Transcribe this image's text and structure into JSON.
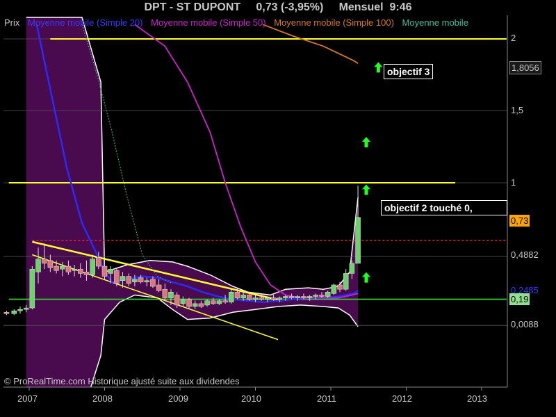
{
  "header": {
    "title": "DPT - ST DUPONT",
    "price": "0,73 (-3,95%)",
    "period": "Mensuel",
    "time": "9:46"
  },
  "legend": [
    {
      "label": "Prix",
      "color": "#c8c8c8"
    },
    {
      "label": "Moyenne mobile (Simple 20)",
      "color": "#3a3aff"
    },
    {
      "label": "Moyenne mobile (Simple 50)",
      "color": "#d020d0"
    },
    {
      "label": "Moyenne mobile (Simple 100)",
      "color": "#d87a20"
    },
    {
      "label": "Moyenne mobile",
      "color": "#3fbf9f"
    }
  ],
  "annotations": {
    "target3": "objectif 3",
    "target2": "objectif 2   touché 0,"
  },
  "copyright": "© ProRealTime.com Historique ajusté suite aux dividendes",
  "colors": {
    "background": "#000000",
    "bollinger_fill": "#4a0a4e",
    "up_candle": "#6ad46a",
    "down_candle": "#d87878",
    "trendline": "#ffff30",
    "resistance": "#ff2020",
    "arrow": "#22ff22"
  },
  "chart_data": {
    "type": "candlestick",
    "title": "DPT - ST DUPONT",
    "x_ticks": [
      "2007",
      "2008",
      "2009",
      "2010",
      "2011",
      "2012",
      "2013"
    ],
    "y_ticks": [
      "0,0088",
      "0,4882",
      "1",
      "1,5",
      "2"
    ],
    "y_markers": [
      {
        "label": "1,8056",
        "value": 1.8056,
        "style": "box-dark"
      },
      {
        "label": "0,73",
        "value": 0.73,
        "style": "box-orange"
      },
      {
        "label": "0,2485",
        "value": 0.2485,
        "style": "label-blue"
      },
      {
        "label": "0,19",
        "value": 0.19,
        "style": "box-green"
      }
    ],
    "ylim": [
      -0.45,
      2.15
    ],
    "candles": [
      {
        "t": 2006.7,
        "o": 0.1,
        "h": 0.11,
        "l": 0.08,
        "c": 0.09
      },
      {
        "t": 2006.8,
        "o": 0.09,
        "h": 0.12,
        "l": 0.08,
        "c": 0.11
      },
      {
        "t": 2006.88,
        "o": 0.11,
        "h": 0.14,
        "l": 0.09,
        "c": 0.12
      },
      {
        "t": 2006.96,
        "o": 0.12,
        "h": 0.15,
        "l": 0.1,
        "c": 0.13
      },
      {
        "t": 2007.04,
        "o": 0.13,
        "h": 0.42,
        "l": 0.12,
        "c": 0.4
      },
      {
        "t": 2007.12,
        "o": 0.38,
        "h": 0.55,
        "l": 0.3,
        "c": 0.47
      },
      {
        "t": 2007.2,
        "o": 0.47,
        "h": 0.58,
        "l": 0.4,
        "c": 0.44
      },
      {
        "t": 2007.28,
        "o": 0.46,
        "h": 0.5,
        "l": 0.38,
        "c": 0.41
      },
      {
        "t": 2007.36,
        "o": 0.42,
        "h": 0.46,
        "l": 0.37,
        "c": 0.39
      },
      {
        "t": 2007.44,
        "o": 0.4,
        "h": 0.45,
        "l": 0.35,
        "c": 0.42
      },
      {
        "t": 2007.52,
        "o": 0.42,
        "h": 0.46,
        "l": 0.36,
        "c": 0.38
      },
      {
        "t": 2007.6,
        "o": 0.39,
        "h": 0.43,
        "l": 0.35,
        "c": 0.4
      },
      {
        "t": 2007.68,
        "o": 0.4,
        "h": 0.44,
        "l": 0.34,
        "c": 0.37
      },
      {
        "t": 2007.76,
        "o": 0.38,
        "h": 0.46,
        "l": 0.32,
        "c": 0.36
      },
      {
        "t": 2007.84,
        "o": 0.36,
        "h": 0.5,
        "l": 0.34,
        "c": 0.47
      },
      {
        "t": 2007.92,
        "o": 0.48,
        "h": 0.52,
        "l": 0.4,
        "c": 0.42
      },
      {
        "t": 2008.0,
        "o": 0.42,
        "h": 0.45,
        "l": 0.33,
        "c": 0.35
      },
      {
        "t": 2008.08,
        "o": 0.37,
        "h": 0.42,
        "l": 0.3,
        "c": 0.4
      },
      {
        "t": 2008.16,
        "o": 0.39,
        "h": 0.41,
        "l": 0.28,
        "c": 0.3
      },
      {
        "t": 2008.24,
        "o": 0.32,
        "h": 0.38,
        "l": 0.27,
        "c": 0.35
      },
      {
        "t": 2008.32,
        "o": 0.35,
        "h": 0.37,
        "l": 0.28,
        "c": 0.3
      },
      {
        "t": 2008.4,
        "o": 0.31,
        "h": 0.36,
        "l": 0.28,
        "c": 0.33
      },
      {
        "t": 2008.48,
        "o": 0.34,
        "h": 0.36,
        "l": 0.3,
        "c": 0.31
      },
      {
        "t": 2008.56,
        "o": 0.31,
        "h": 0.34,
        "l": 0.28,
        "c": 0.32
      },
      {
        "t": 2008.64,
        "o": 0.33,
        "h": 0.35,
        "l": 0.27,
        "c": 0.28
      },
      {
        "t": 2008.72,
        "o": 0.29,
        "h": 0.33,
        "l": 0.24,
        "c": 0.25
      },
      {
        "t": 2008.8,
        "o": 0.26,
        "h": 0.3,
        "l": 0.18,
        "c": 0.2
      },
      {
        "t": 2008.88,
        "o": 0.2,
        "h": 0.26,
        "l": 0.15,
        "c": 0.24
      },
      {
        "t": 2008.96,
        "o": 0.22,
        "h": 0.24,
        "l": 0.13,
        "c": 0.15
      },
      {
        "t": 2009.04,
        "o": 0.16,
        "h": 0.21,
        "l": 0.14,
        "c": 0.19
      },
      {
        "t": 2009.12,
        "o": 0.19,
        "h": 0.2,
        "l": 0.12,
        "c": 0.14
      },
      {
        "t": 2009.2,
        "o": 0.14,
        "h": 0.18,
        "l": 0.12,
        "c": 0.16
      },
      {
        "t": 2009.28,
        "o": 0.16,
        "h": 0.18,
        "l": 0.13,
        "c": 0.14
      },
      {
        "t": 2009.36,
        "o": 0.15,
        "h": 0.19,
        "l": 0.14,
        "c": 0.18
      },
      {
        "t": 2009.44,
        "o": 0.18,
        "h": 0.2,
        "l": 0.15,
        "c": 0.16
      },
      {
        "t": 2009.52,
        "o": 0.16,
        "h": 0.19,
        "l": 0.15,
        "c": 0.18
      },
      {
        "t": 2009.6,
        "o": 0.18,
        "h": 0.22,
        "l": 0.16,
        "c": 0.17
      },
      {
        "t": 2009.68,
        "o": 0.17,
        "h": 0.26,
        "l": 0.16,
        "c": 0.24
      },
      {
        "t": 2009.76,
        "o": 0.24,
        "h": 0.27,
        "l": 0.19,
        "c": 0.2
      },
      {
        "t": 2009.84,
        "o": 0.2,
        "h": 0.24,
        "l": 0.18,
        "c": 0.22
      },
      {
        "t": 2009.92,
        "o": 0.22,
        "h": 0.24,
        "l": 0.18,
        "c": 0.19
      },
      {
        "t": 2010.0,
        "o": 0.19,
        "h": 0.22,
        "l": 0.17,
        "c": 0.2
      },
      {
        "t": 2010.08,
        "o": 0.2,
        "h": 0.23,
        "l": 0.18,
        "c": 0.19
      },
      {
        "t": 2010.16,
        "o": 0.19,
        "h": 0.21,
        "l": 0.17,
        "c": 0.2
      },
      {
        "t": 2010.24,
        "o": 0.2,
        "h": 0.22,
        "l": 0.18,
        "c": 0.19
      },
      {
        "t": 2010.32,
        "o": 0.19,
        "h": 0.21,
        "l": 0.17,
        "c": 0.2
      },
      {
        "t": 2010.4,
        "o": 0.2,
        "h": 0.22,
        "l": 0.18,
        "c": 0.21
      },
      {
        "t": 2010.48,
        "o": 0.21,
        "h": 0.23,
        "l": 0.19,
        "c": 0.2
      },
      {
        "t": 2010.56,
        "o": 0.2,
        "h": 0.22,
        "l": 0.18,
        "c": 0.21
      },
      {
        "t": 2010.64,
        "o": 0.21,
        "h": 0.23,
        "l": 0.19,
        "c": 0.2
      },
      {
        "t": 2010.72,
        "o": 0.2,
        "h": 0.22,
        "l": 0.18,
        "c": 0.21
      },
      {
        "t": 2010.8,
        "o": 0.21,
        "h": 0.23,
        "l": 0.19,
        "c": 0.22
      },
      {
        "t": 2010.88,
        "o": 0.22,
        "h": 0.24,
        "l": 0.2,
        "c": 0.21
      },
      {
        "t": 2010.96,
        "o": 0.21,
        "h": 0.25,
        "l": 0.2,
        "c": 0.24
      },
      {
        "t": 2011.04,
        "o": 0.23,
        "h": 0.3,
        "l": 0.22,
        "c": 0.29
      },
      {
        "t": 2011.12,
        "o": 0.29,
        "h": 0.31,
        "l": 0.24,
        "c": 0.26
      },
      {
        "t": 2011.2,
        "o": 0.26,
        "h": 0.4,
        "l": 0.25,
        "c": 0.37
      },
      {
        "t": 2011.28,
        "o": 0.37,
        "h": 0.46,
        "l": 0.33,
        "c": 0.44
      },
      {
        "t": 2011.36,
        "o": 0.44,
        "h": 0.98,
        "l": 0.44,
        "c": 0.76
      }
    ],
    "series": [
      {
        "name": "Moyenne mobile (Simple 20)",
        "color": "#2a2aff",
        "points": [
          [
            2007.1,
            2.1
          ],
          [
            2007.3,
            1.6
          ],
          [
            2007.5,
            1.1
          ],
          [
            2007.7,
            0.72
          ],
          [
            2007.9,
            0.5
          ],
          [
            2008.0,
            0.38
          ],
          [
            2008.1,
            0.31
          ],
          [
            2008.3,
            0.33
          ],
          [
            2008.5,
            0.35
          ],
          [
            2008.7,
            0.34
          ],
          [
            2008.9,
            0.31
          ],
          [
            2009.1,
            0.28
          ],
          [
            2009.3,
            0.24
          ],
          [
            2009.5,
            0.21
          ],
          [
            2009.7,
            0.19
          ],
          [
            2009.9,
            0.18
          ],
          [
            2010.1,
            0.17
          ],
          [
            2010.3,
            0.18
          ],
          [
            2010.5,
            0.19
          ],
          [
            2010.7,
            0.2
          ],
          [
            2010.9,
            0.2
          ],
          [
            2011.1,
            0.21
          ],
          [
            2011.3,
            0.23
          ],
          [
            2011.36,
            0.25
          ]
        ]
      },
      {
        "name": "Moyenne mobile (Simple 50)",
        "color": "#d020d0",
        "points": [
          [
            2008.4,
            2.1
          ],
          [
            2008.8,
            1.95
          ],
          [
            2009.1,
            1.7
          ],
          [
            2009.4,
            1.35
          ],
          [
            2009.6,
            1.0
          ],
          [
            2009.8,
            0.7
          ],
          [
            2010.0,
            0.45
          ],
          [
            2010.2,
            0.29
          ],
          [
            2010.4,
            0.22
          ],
          [
            2010.6,
            0.2
          ],
          [
            2010.9,
            0.2
          ],
          [
            2011.1,
            0.2
          ],
          [
            2011.2,
            0.21
          ],
          [
            2011.36,
            0.23
          ]
        ]
      },
      {
        "name": "Moyenne mobile (Simple 100)",
        "color": "#d87a20",
        "points": [
          [
            2010.1,
            2.1
          ],
          [
            2010.5,
            2.02
          ],
          [
            2010.9,
            1.95
          ],
          [
            2011.1,
            1.9
          ],
          [
            2011.3,
            1.85
          ],
          [
            2011.36,
            1.83
          ]
        ]
      },
      {
        "name": "Moyenne mobile",
        "color": "#3fbf9f",
        "dashed": true,
        "points": [
          [
            2007.7,
            2.1
          ],
          [
            2007.9,
            1.75
          ],
          [
            2008.1,
            1.35
          ],
          [
            2008.3,
            0.9
          ],
          [
            2008.5,
            0.5
          ],
          [
            2008.7,
            0.35
          ],
          [
            2008.9,
            0.3
          ]
        ]
      }
    ],
    "bollinger_upper": [
      [
        2006.96,
        2.15
      ],
      [
        2007.7,
        2.15
      ],
      [
        2007.95,
        1.7
      ],
      [
        2008.0,
        0.38
      ],
      [
        2008.3,
        0.43
      ],
      [
        2008.6,
        0.46
      ],
      [
        2008.9,
        0.45
      ],
      [
        2009.1,
        0.42
      ],
      [
        2009.4,
        0.36
      ],
      [
        2009.7,
        0.28
      ],
      [
        2009.9,
        0.24
      ],
      [
        2010.2,
        0.22
      ],
      [
        2010.4,
        0.26
      ],
      [
        2010.7,
        0.27
      ],
      [
        2010.9,
        0.26
      ],
      [
        2011.1,
        0.28
      ],
      [
        2011.25,
        0.38
      ],
      [
        2011.36,
        0.9
      ]
    ],
    "bollinger_lower": [
      [
        2006.96,
        -0.45
      ],
      [
        2007.8,
        -0.45
      ],
      [
        2007.95,
        -0.2
      ],
      [
        2008.0,
        0.05
      ],
      [
        2008.2,
        0.17
      ],
      [
        2008.4,
        0.22
      ],
      [
        2008.7,
        0.2
      ],
      [
        2008.9,
        0.12
      ],
      [
        2009.1,
        0.05
      ],
      [
        2009.4,
        0.06
      ],
      [
        2009.7,
        0.1
      ],
      [
        2010.0,
        0.12
      ],
      [
        2010.3,
        0.14
      ],
      [
        2010.6,
        0.15
      ],
      [
        2010.9,
        0.14
      ],
      [
        2011.1,
        0.13
      ],
      [
        2011.25,
        0.08
      ],
      [
        2011.36,
        0.0
      ]
    ],
    "horizontal_lines": [
      {
        "value": 2.0,
        "color": "#ffff30",
        "x_start": 2007.28,
        "x_end": 2013.33
      },
      {
        "value": 1.0,
        "color": "#ffff30",
        "x_start": 2006.73,
        "x_end": 2012.65
      },
      {
        "value": 0.6,
        "color": "#ff2020",
        "dashed": true,
        "x_start": 2007.04,
        "x_end": 2013.33
      },
      {
        "value": 0.19,
        "color": "#30c030",
        "x_start": 2006.73,
        "x_end": 2013.33
      }
    ],
    "trendlines": [
      {
        "from": [
          2007.04,
          0.59
        ],
        "to": [
          2010.35,
          0.18
        ],
        "width": 2.5
      },
      {
        "from": [
          2007.04,
          0.5
        ],
        "to": [
          2010.3,
          -0.09
        ],
        "width": 1.5
      }
    ],
    "arrows": [
      {
        "t": 2011.63,
        "v": 1.8
      },
      {
        "t": 2011.47,
        "v": 1.28
      },
      {
        "t": 2011.47,
        "v": 0.95
      },
      {
        "t": 2011.47,
        "v": 0.34
      }
    ]
  }
}
